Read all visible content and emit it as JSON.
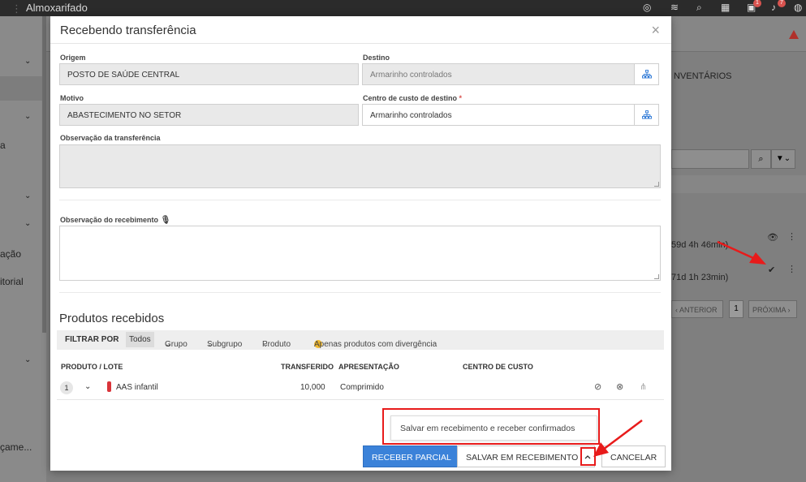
{
  "topbar": {
    "app_title": "Almoxarifado",
    "separator": "⋮",
    "badges": [
      "1",
      "7"
    ]
  },
  "background": {
    "sidebar_items": [
      "a",
      "ação",
      "itorial",
      "çame..."
    ],
    "tab_label": "NVENTÁRIOS",
    "timers": [
      "59d 4h 46min)",
      "71d 1h 23min)"
    ],
    "pagination": {
      "prev": "‹ ANTERIOR",
      "page": "1",
      "next": "PRÓXIMA ›"
    }
  },
  "modal": {
    "title": "Recebendo transferência",
    "close": "×",
    "origem": {
      "label": "Origem",
      "value": "POSTO DE SAÚDE CENTRAL"
    },
    "destino": {
      "label": "Destino",
      "value": "Armarinho controlados"
    },
    "motivo": {
      "label": "Motivo",
      "value": "ABASTECIMENTO NO SETOR"
    },
    "centro_custo": {
      "label": "Centro de custo de destino",
      "required": "*",
      "value": "Armarinho controlados"
    },
    "obs_transferencia": {
      "label": "Observação da transferência"
    },
    "obs_recebimento": {
      "label": "Observação do recebimento"
    },
    "produtos": {
      "title": "Produtos recebidos",
      "filter": {
        "title": "FILTRAR POR",
        "todos": "Todos",
        "grupo": "Grupo",
        "subgrupo": "Subgrupo",
        "produto": "Produto",
        "divergencia": "Apenas produtos com divergência"
      },
      "columns": {
        "produto": "PRODUTO / LOTE",
        "transferido": "TRANSFERIDO",
        "apresentacao": "APRESENTAÇÃO",
        "centro": "CENTRO DE CUSTO"
      },
      "rows": [
        {
          "num": "1",
          "name": "AAS infantil",
          "transferido": "10,000",
          "apresentacao": "Comprimido"
        }
      ]
    },
    "dropdown_option": "Salvar em recebimento e receber confirmados",
    "buttons": {
      "receber_parcial": "RECEBER PARCIAL",
      "salvar_recebimento": "SALVAR EM RECEBIMENTO",
      "cancelar": "CANCELAR"
    }
  },
  "colors": {
    "primary": "#3b82d9",
    "annotation": "#e81b1b",
    "required": "#d9534f",
    "divergence": "#f0b82c",
    "product_tag": "#d9343a"
  }
}
